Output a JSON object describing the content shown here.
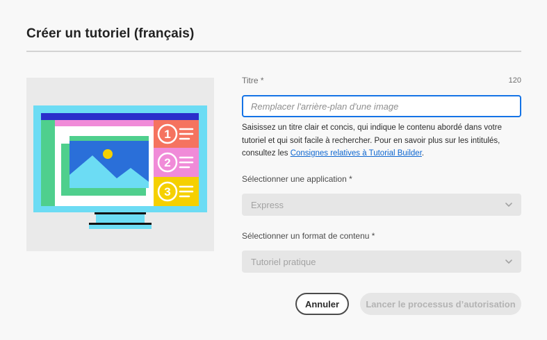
{
  "dialog": {
    "title": "Créer un tutoriel (français)"
  },
  "illustration": {
    "icon": "monitor-with-image-and-numbered-list-illustration",
    "steps": [
      "1",
      "2",
      "3"
    ],
    "colors": {
      "screen": "#6cdcf4",
      "topbar": "#2a2ecb",
      "sidebar": "#4fcf8d",
      "pink": "#f08bd8",
      "image_bg": "#2a6fd9",
      "mountains": "#6cdcf4",
      "sun": "#f5d000",
      "step1": "#f5735f",
      "step2": "#f08bd8",
      "step3": "#f5d000"
    }
  },
  "form": {
    "title_label": "Titre *",
    "title_char_count": "120",
    "title_value": "",
    "title_placeholder": "Remplacer l'arrière-plan d'une image",
    "help_text": "Saisissez un titre clair et concis, qui indique le contenu abordé dans votre tutoriel et qui soit facile à rechercher. Pour en savoir plus sur les intitulés, consultez les ",
    "help_link": "Consignes relatives à Tutorial Builder",
    "help_suffix": ".",
    "app_label": "Sélectionner une application *",
    "app_value": "Express",
    "format_label": "Sélectionner un format de contenu *",
    "format_value": "Tutoriel pratique"
  },
  "actions": {
    "cancel_label": "Annuler",
    "submit_label": "Lancer le processus d’autorisation"
  },
  "theme": {
    "accent": "#1473e6",
    "link": "#0d66d0",
    "disabled_bg": "#e6e6e6",
    "disabled_text": "#b3b3b3"
  }
}
